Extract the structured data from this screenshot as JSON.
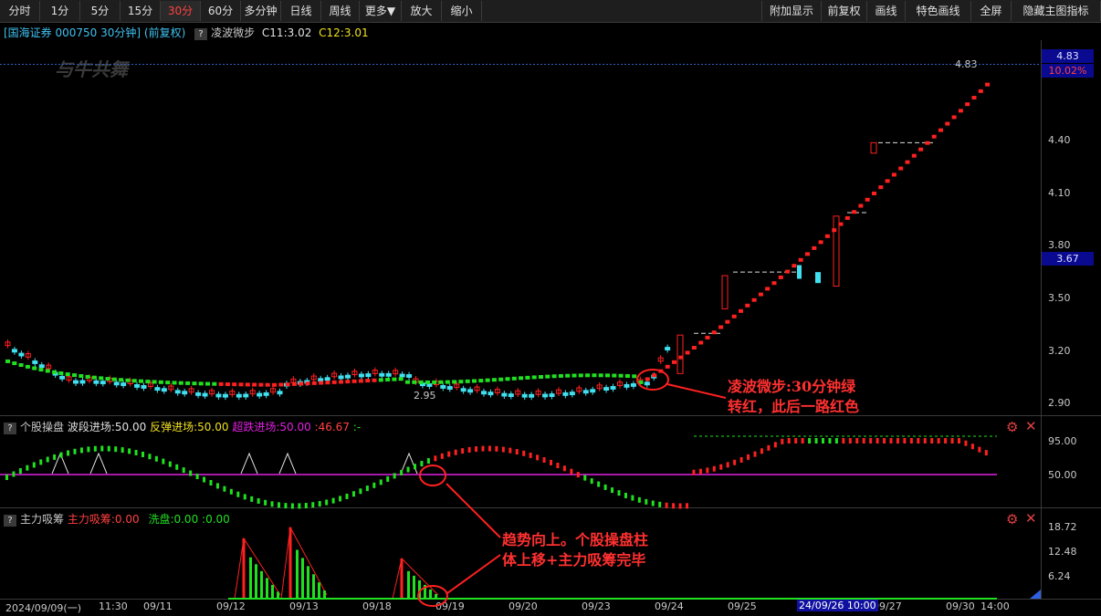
{
  "toolbar": {
    "left": [
      "分时",
      "1分",
      "5分",
      "15分",
      "30分",
      "60分",
      "多分钟",
      "日线",
      "周线",
      "更多▼",
      "放大",
      "缩小"
    ],
    "active": "30分",
    "right": [
      "附加显示",
      "前复权",
      "画线",
      "特色画线",
      "全屏",
      "隐藏主图指标"
    ]
  },
  "main": {
    "title": "[国海证券 000750 30分钟] (前复权)",
    "indicator_name": "凌波微步",
    "c11": "C11:3.02",
    "c12": "C12:3.01",
    "watermark": "与牛共舞",
    "price_high_label": "4.83",
    "price_low_label": "2.95",
    "top_price": "4.83",
    "top_pct": "10.02%",
    "cursor_price": "3.67",
    "ticks": [
      "4.40",
      "4.10",
      "3.80",
      "3.50",
      "3.20",
      "2.90"
    ]
  },
  "sub1": {
    "name": "个股操盘",
    "l1": "波段进场:50.00",
    "l2": "反弹进场:50.00",
    "l3": "超跌进场:50.00",
    "l4": ":46.67",
    "l5": ":-",
    "ticks": [
      "95.00",
      "50.00"
    ]
  },
  "sub2": {
    "name": "主力吸筹",
    "l1": "主力吸筹:0.00",
    "l2": "洗盘:0.00",
    "l3": ":0.00",
    "ticks": [
      "18.72",
      "12.48",
      "6.24"
    ]
  },
  "xaxis": {
    "labels": [
      "2024/09/09(一)",
      "11:30",
      "09/11",
      "09/12",
      "09/13",
      "09/18",
      "09/19",
      "09/20",
      "09/23",
      "09/24",
      "09/25",
      "09/27",
      "09/30",
      "14:00"
    ],
    "highlight": "24/09/26 10:00"
  },
  "annotations": {
    "a1_line1": "凌波微步:30分钟绿",
    "a1_line2": "转红，此后一路红色",
    "a2_line1": "趋势向上。个股操盘柱",
    "a2_line2": "体上移+主力吸筹完毕"
  },
  "colors": {
    "up": "#ff2020",
    "down": "#40e0f0",
    "green": "#20e020",
    "magenta": "#e020e0",
    "bg": "#000000"
  }
}
